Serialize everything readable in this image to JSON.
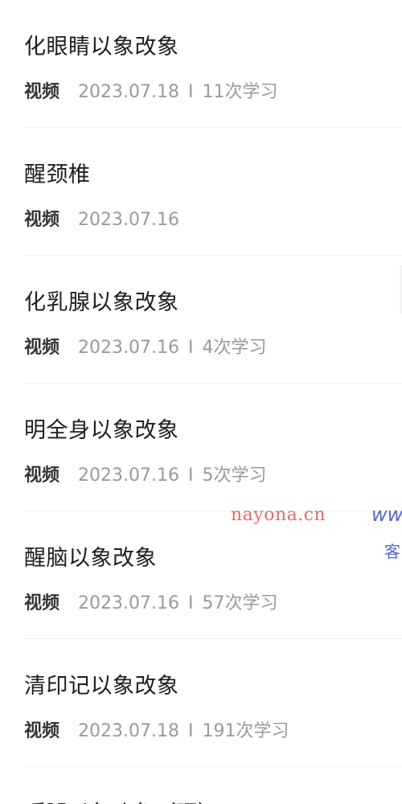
{
  "items": [
    {
      "title": "化眼睛以象改象",
      "type": "视频",
      "date": "2023.07.18",
      "separator": "I",
      "count": "11次学习"
    },
    {
      "title": "醒颈椎",
      "type": "视频",
      "date": "2023.07.16",
      "separator": "",
      "count": ""
    },
    {
      "title": "化乳腺以象改象",
      "type": "视频",
      "date": "2023.07.16",
      "separator": "I",
      "count": "4次学习"
    },
    {
      "title": "明全身以象改象",
      "type": "视频",
      "date": "2023.07.16",
      "separator": "I",
      "count": "5次学习"
    },
    {
      "title": "醒脑以象改象",
      "type": "视频",
      "date": "2023.07.16",
      "separator": "I",
      "count": "57次学习"
    },
    {
      "title": "清印记以象改象",
      "type": "视频",
      "date": "2023.07.18",
      "separator": "I",
      "count": "191次学习"
    }
  ],
  "partial_item": {
    "title": "暖腿以象改象（理）"
  },
  "watermark": {
    "site": "nayona.cn",
    "www": "www",
    "ke": "客"
  },
  "colors": {
    "title": "#1e1e1e",
    "meta": "#9a9a9a",
    "watermark_red": "#e36b6b",
    "watermark_blue": "#5566cc"
  }
}
